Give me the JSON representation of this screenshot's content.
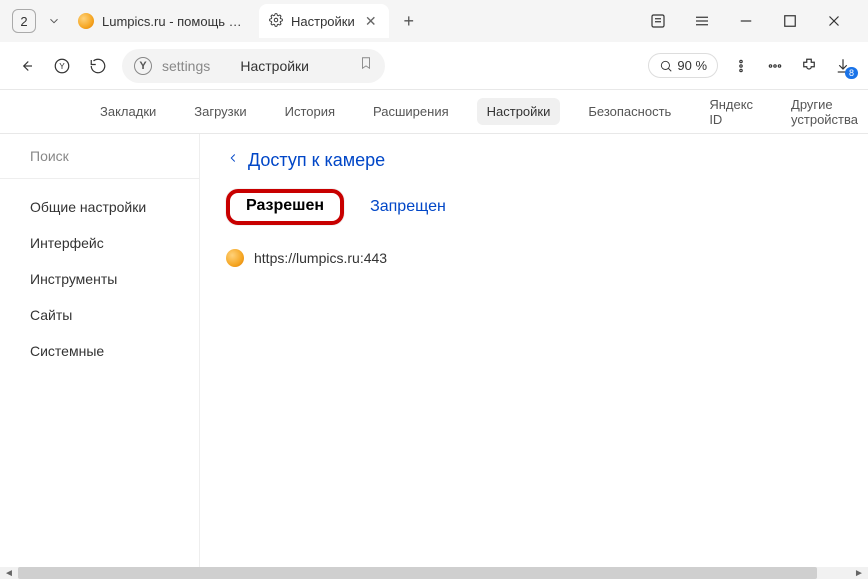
{
  "window": {
    "tab_count": "2",
    "tabs": [
      {
        "title": "Lumpics.ru - помощь с ко"
      },
      {
        "title": "Настройки"
      }
    ]
  },
  "addr": {
    "url": "settings",
    "pagetitle": "Настройки",
    "zoom": "90 %",
    "dl_badge": "8"
  },
  "subnav": {
    "items": [
      "Закладки",
      "Загрузки",
      "История",
      "Расширения",
      "Настройки",
      "Безопасность",
      "Яндекс ID",
      "Другие устройства"
    ],
    "active_index": 4
  },
  "sidebar": {
    "search_placeholder": "Поиск",
    "items": [
      "Общие настройки",
      "Интерфейс",
      "Инструменты",
      "Сайты",
      "Системные"
    ]
  },
  "content": {
    "breadcrumb": "Доступ к камере",
    "tabs": {
      "allowed": "Разрешен",
      "blocked": "Запрещен"
    },
    "sites": [
      {
        "url": "https://lumpics.ru:443"
      }
    ]
  }
}
